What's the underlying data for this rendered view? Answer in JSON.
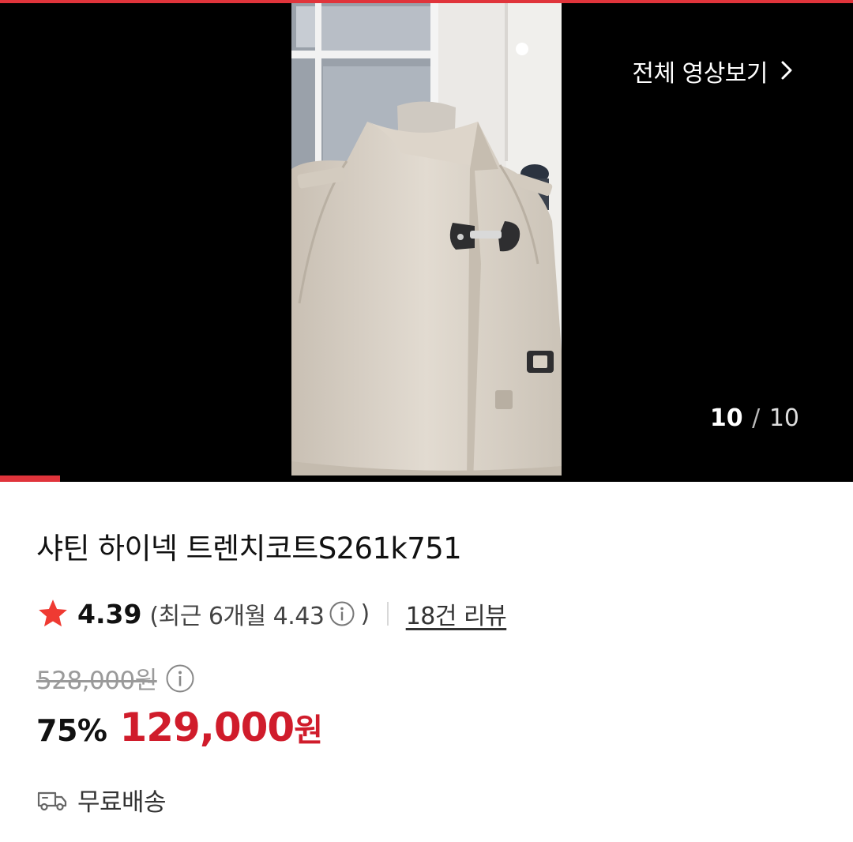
{
  "viewer": {
    "full_video_label": "전체 영상보기",
    "counter_current": "10",
    "counter_separator": "/",
    "counter_total": "10",
    "progress_fraction": 0.07
  },
  "product": {
    "title": "샤틴 하이넥 트렌치코트S261k751",
    "rating": "4.39",
    "recent_open": "(최근 6개월 4.43",
    "recent_close": ")",
    "review_link": "18건 리뷰",
    "original_price": "528,000원",
    "discount": "75%",
    "sale_price": "129,000",
    "sale_currency": "원",
    "shipping": "무료배송"
  },
  "colors": {
    "accent": "#e0343b",
    "sale_price": "#d01c2b",
    "star": "#ef3a32"
  },
  "icons": {
    "rating": "star-icon",
    "recent_info": "info-icon",
    "price_info": "info-icon",
    "shipping": "truck-icon",
    "full_video": "chevron-right-icon"
  }
}
